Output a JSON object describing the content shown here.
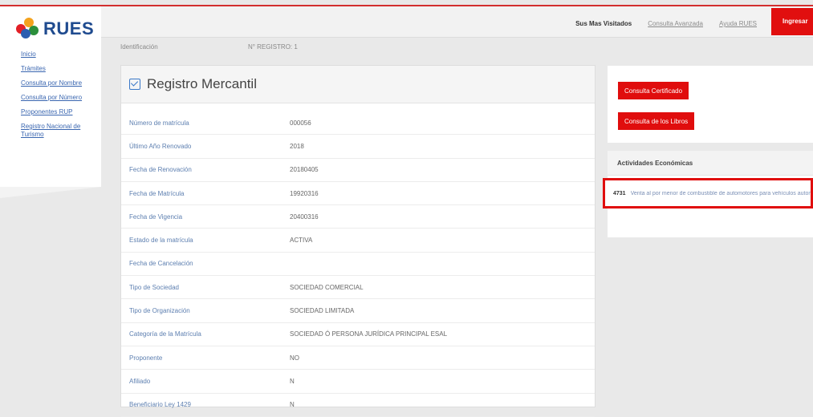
{
  "brand": {
    "name": "RUES"
  },
  "sidebar": {
    "links": [
      "Inicio",
      "Trámites",
      "Consulta por Nombre",
      "Consulta por Número",
      "Proponentes RUP",
      "Registro Nacional de Turismo"
    ]
  },
  "header": {
    "nav": [
      "Sus Mas Visitados",
      "Consulta Avanzada",
      "Ayuda RUES"
    ],
    "cta": "Ingresar"
  },
  "breadcrumb": {
    "left": "Identificación",
    "right": "N° REGISTRO: 1"
  },
  "panel": {
    "title": "Registro Mercantil",
    "rows": [
      {
        "label": "Número de matrícula",
        "value": "000056"
      },
      {
        "label": "Último Año Renovado",
        "value": "2018"
      },
      {
        "label": "Fecha de Renovación",
        "value": "20180405"
      },
      {
        "label": "Fecha de Matrícula",
        "value": "19920316"
      },
      {
        "label": "Fecha de Vigencia",
        "value": "20400316"
      },
      {
        "label": "Estado de la matrícula",
        "value": "ACTIVA"
      },
      {
        "label": "Fecha de Cancelación",
        "value": ""
      },
      {
        "label": "Tipo de Sociedad",
        "value": "SOCIEDAD COMERCIAL"
      },
      {
        "label": "Tipo de Organización",
        "value": "SOCIEDAD LIMITADA"
      },
      {
        "label": "Categoría de la Matrícula",
        "value": "SOCIEDAD Ó PERSONA JURÍDICA PRINCIPAL ESAL"
      },
      {
        "label": "Proponente",
        "value": "NO"
      },
      {
        "label": "Afiliado",
        "value": "N"
      },
      {
        "label": "Beneficiario Ley 1429",
        "value": "N"
      }
    ]
  },
  "right": {
    "buttons": [
      "Consulta Certificado",
      "Consulta de los Libros"
    ],
    "activities_title": "Actividades Económicas",
    "activity_code": "4731",
    "activity_text": "Venta al por menor de combustible de automotores para vehículos automotores"
  },
  "colors": {
    "accent": "#e00d0d",
    "brand_blue": "#1f4b8f",
    "link": "#3a66b0"
  }
}
